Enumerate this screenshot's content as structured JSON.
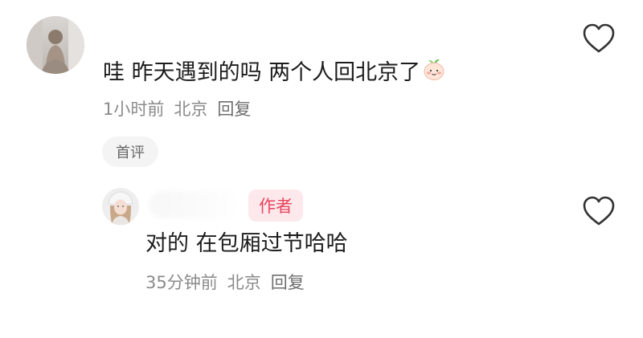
{
  "comment": {
    "avatar": "user-avatar-photo",
    "text": "哇 昨天遇到的吗 两个人回北京了",
    "emoji": "smiling-peach-emoji",
    "time": "1小时前",
    "location": "北京",
    "reply_label": "回复",
    "badge": "首评",
    "like_icon": "heart-outline-icon"
  },
  "reply": {
    "avatar": "author-avatar-photo",
    "author_badge": "作者",
    "text": "对的 在包厢过节哈哈",
    "time": "35分钟前",
    "location": "北京",
    "reply_label": "回复",
    "like_icon": "heart-outline-icon"
  },
  "colors": {
    "text_primary": "#1c1c1c",
    "text_secondary": "#8a8a8a",
    "author_badge_bg": "#fde8ec",
    "author_badge_text": "#e8455e",
    "chip_bg": "#f4f4f4"
  }
}
